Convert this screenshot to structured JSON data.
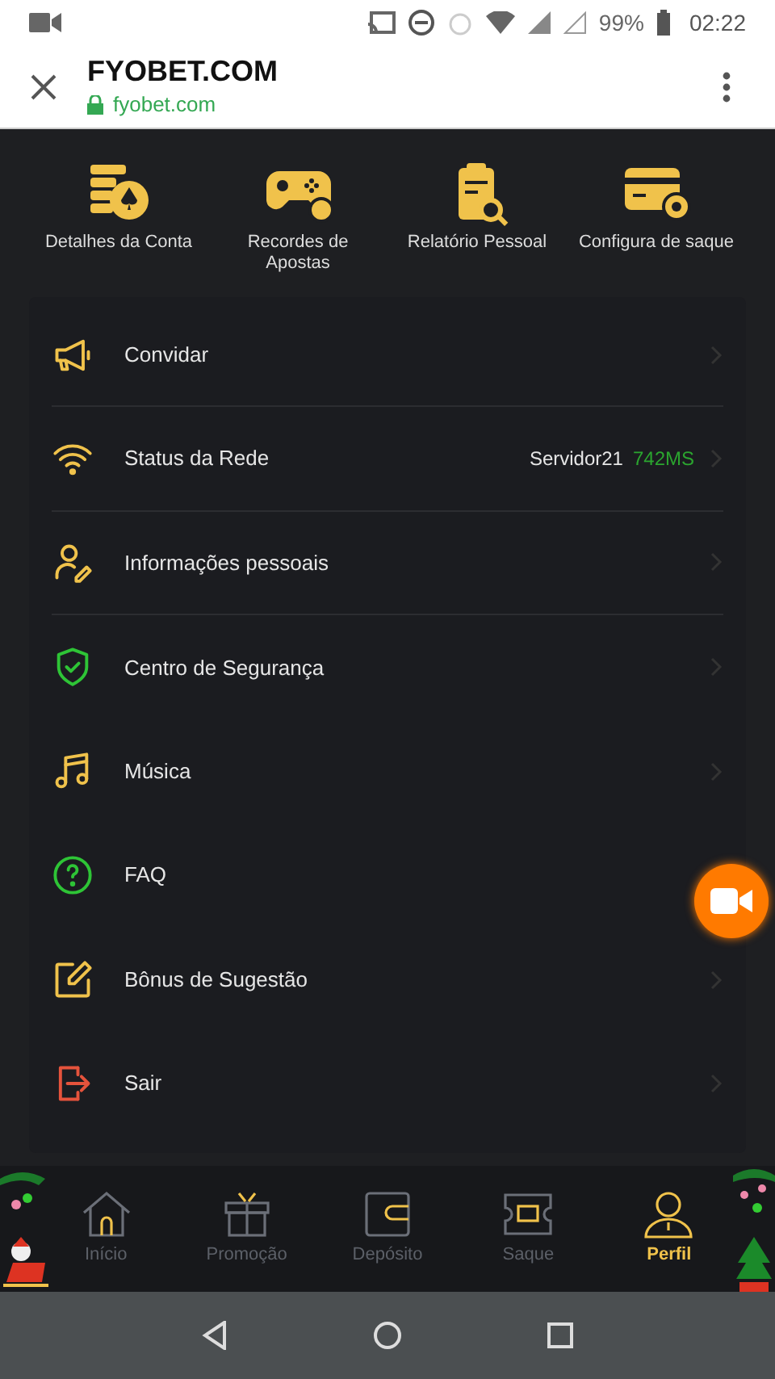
{
  "status_bar": {
    "battery": "99%",
    "time": "02:22"
  },
  "browser": {
    "title": "FYOBET.COM",
    "url": "fyobet.com"
  },
  "shortcuts": [
    {
      "kind": "coins",
      "label": "Detalhes da Conta"
    },
    {
      "kind": "gamepad",
      "label": "Recordes de Apostas"
    },
    {
      "kind": "report",
      "label": "Relatório Pessoal"
    },
    {
      "kind": "card",
      "label": "Configura de saque"
    }
  ],
  "menu": [
    {
      "kind": "megaphone",
      "label": "Convidar",
      "chevron": true
    },
    {
      "kind": "wifi",
      "label": "Status da Rede",
      "server": "Servidor21",
      "latency": "742MS",
      "chevron": true
    },
    {
      "kind": "user",
      "label": "Informações pessoais",
      "chevron": true
    },
    {
      "kind": "shield",
      "label": "Centro de Segurança",
      "chevron": true
    },
    {
      "kind": "music",
      "label": "Música",
      "chevron": true
    },
    {
      "kind": "faq",
      "label": "FAQ",
      "chevron": false
    },
    {
      "kind": "edit",
      "label": "Bônus de Sugestão",
      "chevron": true
    },
    {
      "kind": "exit",
      "label": "Sair",
      "chevron": true
    }
  ],
  "bottom_nav": [
    {
      "kind": "home",
      "label": "Início",
      "selected": false
    },
    {
      "kind": "gift",
      "label": "Promoção",
      "selected": false
    },
    {
      "kind": "wallet",
      "label": "Depósito",
      "selected": false
    },
    {
      "kind": "ticket",
      "label": "Saque",
      "selected": false
    },
    {
      "kind": "person",
      "label": "Perfil",
      "selected": true
    }
  ]
}
